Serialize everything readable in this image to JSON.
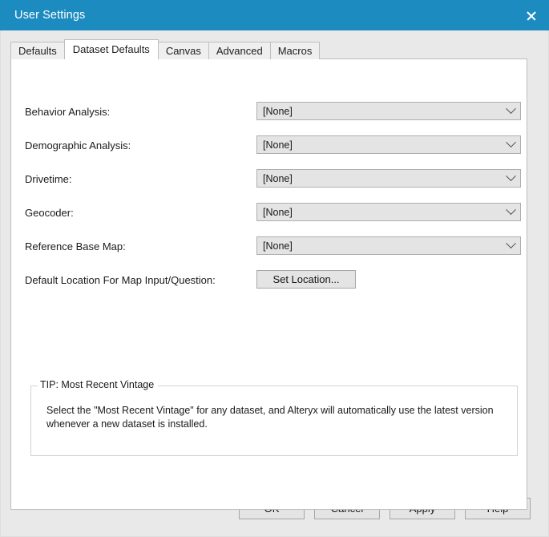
{
  "window": {
    "title": "User Settings",
    "titlebar_color": "#1c8bc0",
    "close_icon": "close-icon",
    "close_label": "Close"
  },
  "tabs": [
    {
      "label": "Defaults",
      "active": false
    },
    {
      "label": "Dataset Defaults",
      "active": true
    },
    {
      "label": "Canvas",
      "active": false
    },
    {
      "label": "Advanced",
      "active": false
    },
    {
      "label": "Macros",
      "active": false
    }
  ],
  "form": {
    "rows": [
      {
        "label": "Behavior Analysis:",
        "value": "[None]",
        "control": "combo"
      },
      {
        "label": "Demographic Analysis:",
        "value": "[None]",
        "control": "combo"
      },
      {
        "label": "Drivetime:",
        "value": "[None]",
        "control": "combo"
      },
      {
        "label": "Geocoder:",
        "value": "[None]",
        "control": "combo"
      },
      {
        "label": "Reference Base Map:",
        "value": "[None]",
        "control": "combo"
      }
    ],
    "location_row": {
      "label": "Default Location For Map Input/Question:",
      "button_label": "Set Location..."
    }
  },
  "tip": {
    "legend": "TIP: Most Recent Vintage",
    "text": "Select the \"Most Recent Vintage\" for any dataset, and Alteryx will automatically use the latest version whenever a new dataset is installed."
  },
  "footer": {
    "ok": "OK",
    "cancel": "Cancel",
    "apply": "Apply",
    "help": "Help"
  }
}
